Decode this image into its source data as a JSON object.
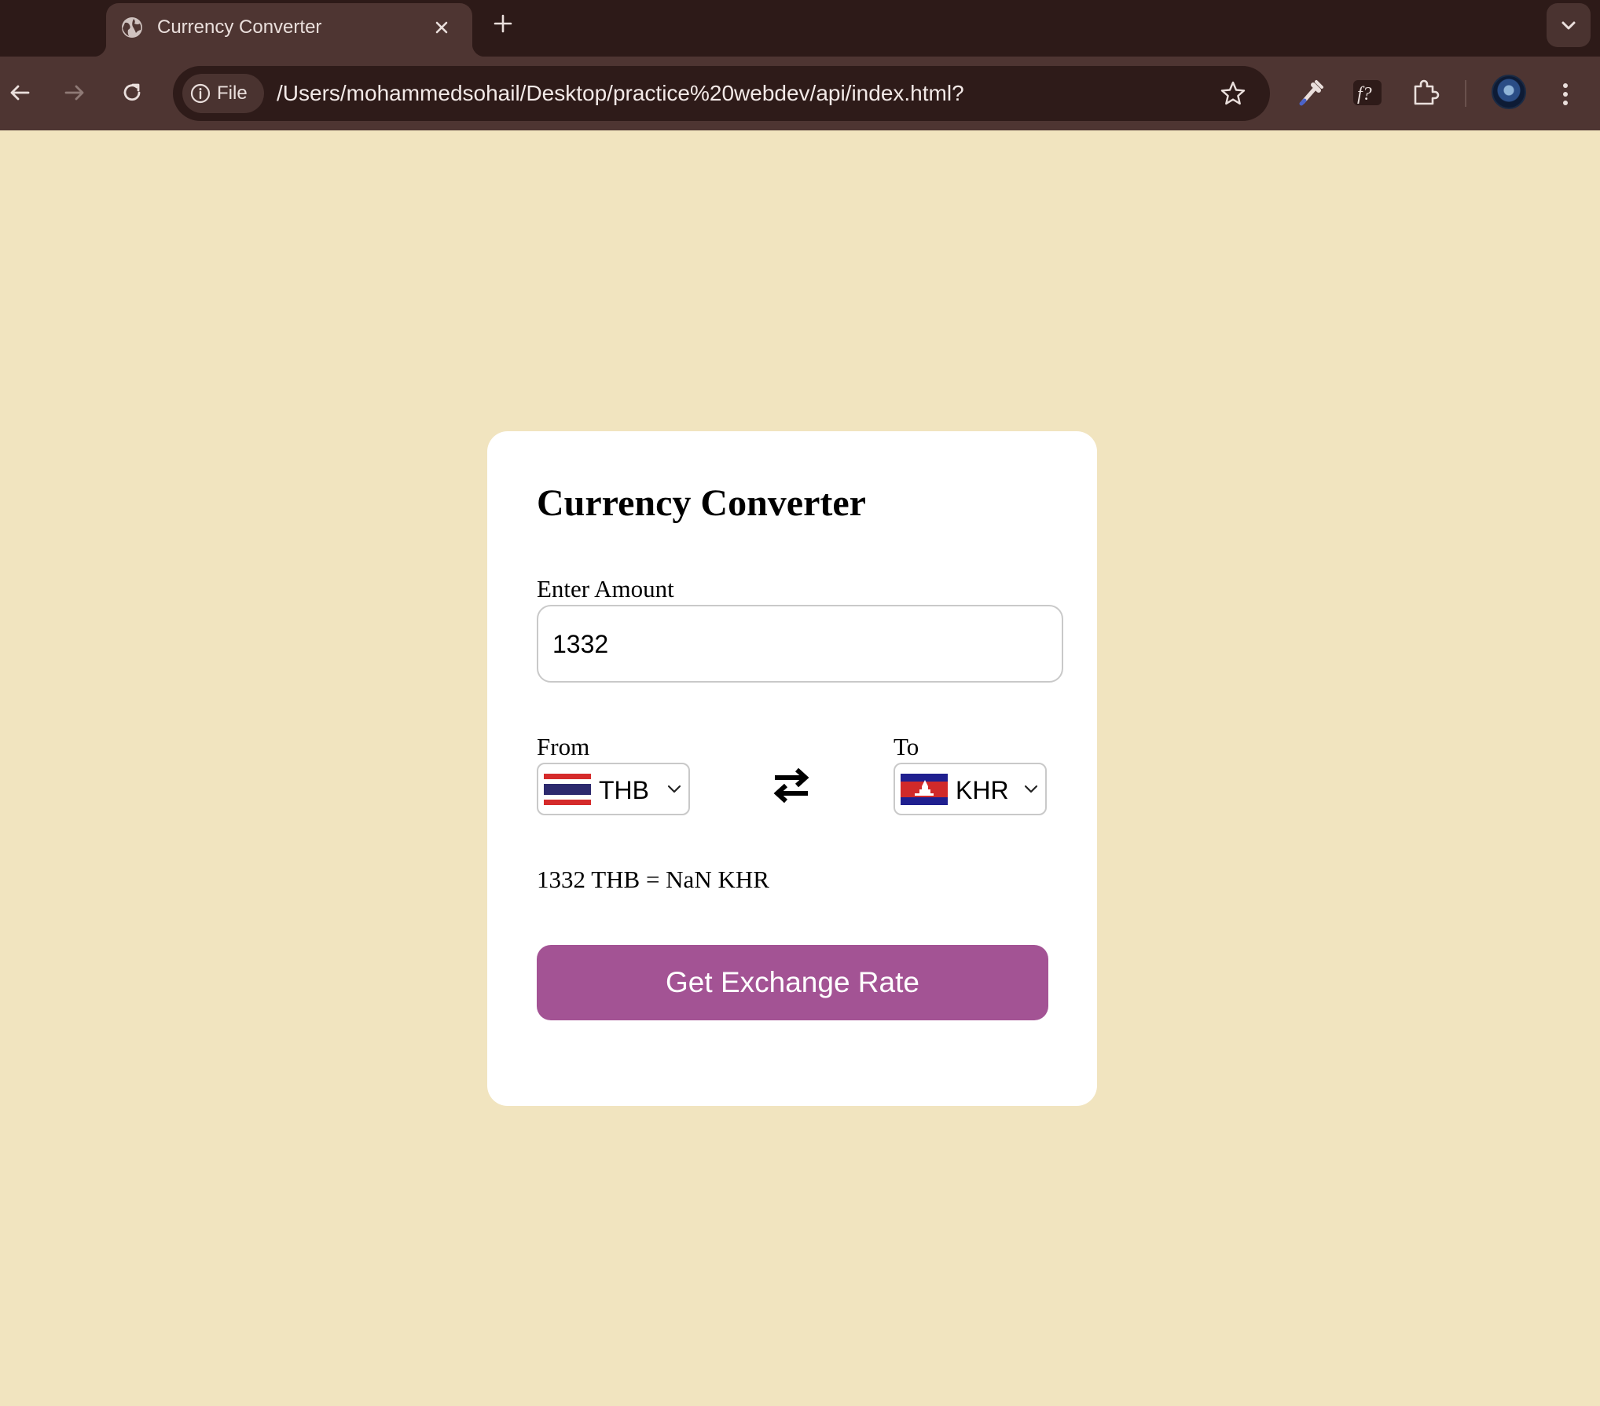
{
  "browser": {
    "tab_title": "Currency Converter",
    "omnibox": {
      "chip_label": "File",
      "url": "/Users/mohammedsohail/Desktop/practice%20webdev/api/index.html?"
    }
  },
  "converter": {
    "title": "Currency Converter",
    "amount_label": "Enter Amount",
    "amount_value": "1332",
    "from_label": "From",
    "to_label": "To",
    "from_currency": "THB",
    "to_currency": "KHR",
    "result": "1332 THB = NaN KHR",
    "button_label": "Get Exchange Rate"
  },
  "colors": {
    "page_background": "#f1e4bf",
    "card_background": "#ffffff",
    "button": "#a35394",
    "chrome_dark": "#2d1a18",
    "chrome_toolbar": "#4e3532"
  }
}
